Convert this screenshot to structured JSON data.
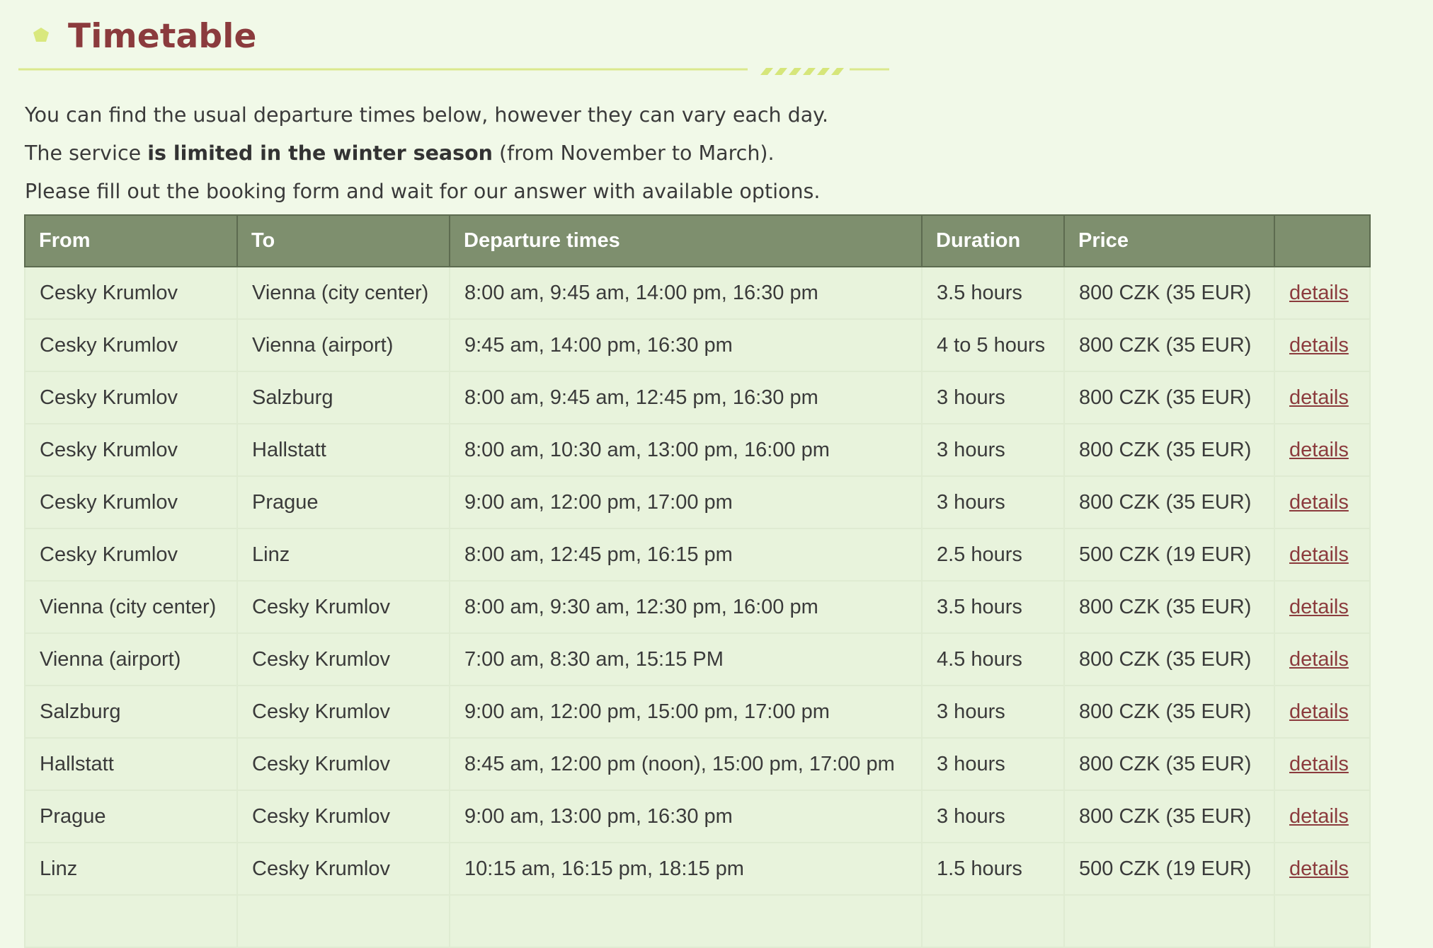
{
  "header": {
    "title": "Timetable"
  },
  "intro": {
    "line1": "You can find the usual departure times below, however they can vary each day.",
    "line2_pre": "The service ",
    "line2_bold": "is limited in the winter season",
    "line2_post": " (from November to March).",
    "line3": "Please fill out the booking form and wait for our answer with available options."
  },
  "colors": {
    "title": "#8b3b3d",
    "header_bg": "#7e8f6e",
    "page_bg": "#f1f9e8",
    "row_bg": "#e8f3dc",
    "accent": "#d6e67a"
  },
  "table": {
    "columns": [
      "From",
      "To",
      "Departure times",
      "Duration",
      "Price",
      ""
    ],
    "rows": [
      {
        "from": "Cesky Krumlov",
        "to": "Vienna (city center)",
        "times": "8:00 am, 9:45 am, 14:00 pm, 16:30 pm",
        "duration": "3.5 hours",
        "price": "800 CZK (35 EUR)",
        "link": "details"
      },
      {
        "from": "Cesky Krumlov",
        "to": "Vienna (airport)",
        "times": "9:45 am, 14:00 pm, 16:30 pm",
        "duration": "4 to 5 hours",
        "price": "800 CZK (35 EUR)",
        "link": "details"
      },
      {
        "from": "Cesky Krumlov",
        "to": "Salzburg",
        "times": "8:00 am, 9:45 am, 12:45 pm, 16:30 pm",
        "duration": "3 hours",
        "price": "800 CZK (35 EUR)",
        "link": "details"
      },
      {
        "from": "Cesky Krumlov",
        "to": "Hallstatt",
        "times": "8:00 am, 10:30 am, 13:00 pm, 16:00 pm",
        "duration": "3 hours",
        "price": "800 CZK (35 EUR)",
        "link": "details"
      },
      {
        "from": "Cesky Krumlov",
        "to": "Prague",
        "times": "9:00 am, 12:00 pm, 17:00 pm",
        "duration": "3 hours",
        "price": "800 CZK (35 EUR)",
        "link": "details"
      },
      {
        "from": "Cesky Krumlov",
        "to": "Linz",
        "times": "8:00 am, 12:45 pm, 16:15 pm",
        "duration": "2.5 hours",
        "price": "500 CZK (19 EUR)",
        "link": "details"
      },
      {
        "from": "Vienna (city center)",
        "to": "Cesky Krumlov",
        "times": "8:00 am, 9:30 am, 12:30 pm, 16:00 pm",
        "duration": "3.5 hours",
        "price": "800 CZK (35 EUR)",
        "link": "details"
      },
      {
        "from": "Vienna (airport)",
        "to": "Cesky Krumlov",
        "times": "7:00 am, 8:30 am, 15:15 PM",
        "duration": "4.5 hours",
        "price": "800 CZK (35 EUR)",
        "link": "details"
      },
      {
        "from": "Salzburg",
        "to": "Cesky Krumlov",
        "times": "9:00 am, 12:00 pm, 15:00 pm, 17:00 pm",
        "duration": "3 hours",
        "price": "800 CZK (35 EUR)",
        "link": "details"
      },
      {
        "from": "Hallstatt",
        "to": "Cesky Krumlov",
        "times": "8:45 am, 12:00 pm (noon), 15:00 pm, 17:00 pm",
        "duration": "3 hours",
        "price": "800 CZK (35 EUR)",
        "link": "details"
      },
      {
        "from": "Prague",
        "to": "Cesky Krumlov",
        "times": "9:00 am, 13:00 pm, 16:30 pm",
        "duration": "3 hours",
        "price": "800 CZK (35 EUR)",
        "link": "details"
      },
      {
        "from": "Linz",
        "to": "Cesky Krumlov",
        "times": "10:15 am, 16:15 pm, 18:15 pm",
        "duration": "1.5 hours",
        "price": "500 CZK (19 EUR)",
        "link": "details"
      },
      {
        "from": "",
        "to": "",
        "times": "",
        "duration": "",
        "price": "",
        "link": ""
      }
    ]
  }
}
